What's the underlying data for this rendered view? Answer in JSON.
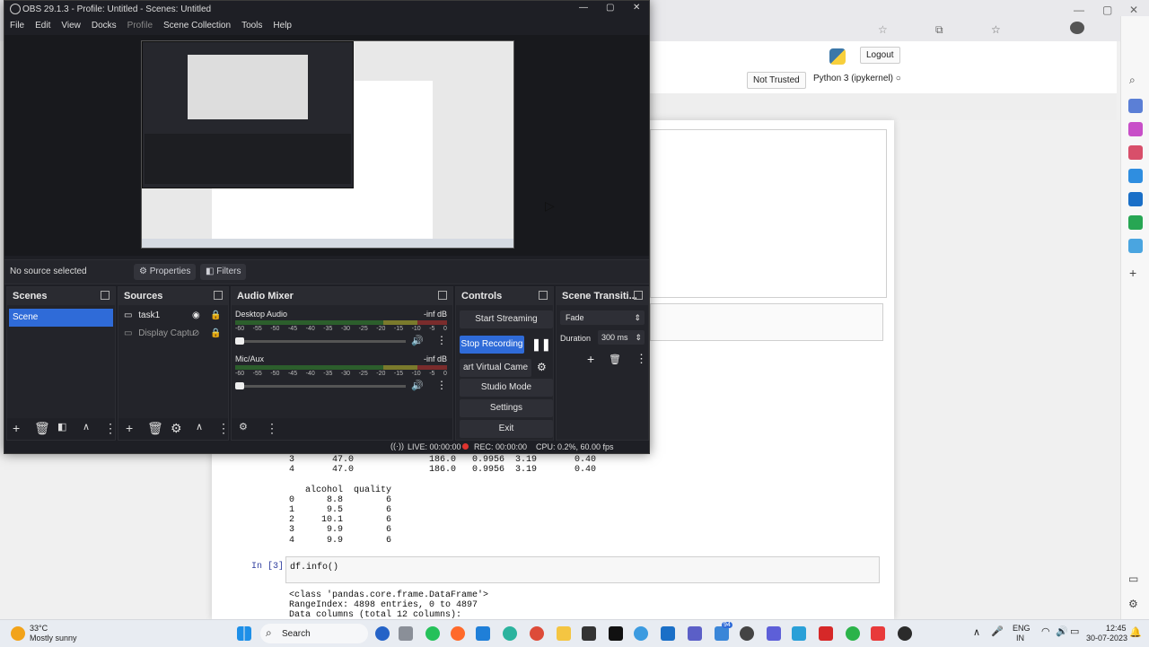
{
  "obs": {
    "title": "OBS 29.1.3 - Profile: Untitled - Scenes: Untitled",
    "menu": [
      "File",
      "Edit",
      "View",
      "Docks",
      "Profile",
      "Scene Collection",
      "Tools",
      "Help"
    ],
    "source_status": "No source selected",
    "properties_label": "Properties",
    "filters_label": "Filters",
    "scenes_header": "Scenes",
    "scenes": [
      "Scene"
    ],
    "sources_header": "Sources",
    "sources": [
      "task1",
      "Display Captu"
    ],
    "mixer_header": "Audio Mixer",
    "mixer_channels": [
      {
        "name": "Desktop Audio",
        "level": "-inf dB"
      },
      {
        "name": "Mic/Aux",
        "level": "-inf dB"
      }
    ],
    "meter_ticks": [
      "-60",
      "-55",
      "-50",
      "-45",
      "-40",
      "-35",
      "-30",
      "-25",
      "-20",
      "-15",
      "-10",
      "-5",
      "0"
    ],
    "controls_header": "Controls",
    "start_streaming": "Start Streaming",
    "stop_recording": "Stop Recording",
    "virtual_cam": "art Virtual Came",
    "studio_mode": "Studio Mode",
    "settings": "Settings",
    "exit": "Exit",
    "transitions_header": "Scene Transiti...",
    "transition": "Fade",
    "duration_label": "Duration",
    "duration_value": "300 ms",
    "live": "LIVE: 00:00:00",
    "rec": "REC: 00:00:00",
    "cpu": "CPU: 0.2%, 60.00 fps"
  },
  "jupyter": {
    "logout": "Logout",
    "trust": "Not Trusted",
    "kernel": "Python 3 (ipykernel)",
    "df_rows_top": [
      "3       47.0              186.0   0.9956  3.19       0.40",
      "4       47.0              186.0   0.9956  3.19       0.40"
    ],
    "alcohol_header": "   alcohol  quality",
    "alcohol_rows": [
      "0      8.8        6",
      "1      9.5        6",
      "2     10.1        6",
      "3      9.9        6",
      "4      9.9        6"
    ],
    "in_prompt": "In [3]:",
    "in_code": "df.info()",
    "out_lines": [
      "<class 'pandas.core.frame.DataFrame'>",
      "RangeIndex: 4898 entries, 0 to 4897",
      "Data columns (total 12 columns):"
    ]
  },
  "taskbar": {
    "temp": "33°C",
    "weather": "Mostly sunny",
    "search": "Search",
    "lang1": "ENG",
    "lang2": "IN",
    "time": "12:45",
    "date": "30-07-2023",
    "badge": "94"
  },
  "colors": {
    "obs_bg": "#1e1f25",
    "obs_accent": "#2f6bd8",
    "taskbar": "#e8ecf2",
    "rec_dot": "#e0342f"
  }
}
